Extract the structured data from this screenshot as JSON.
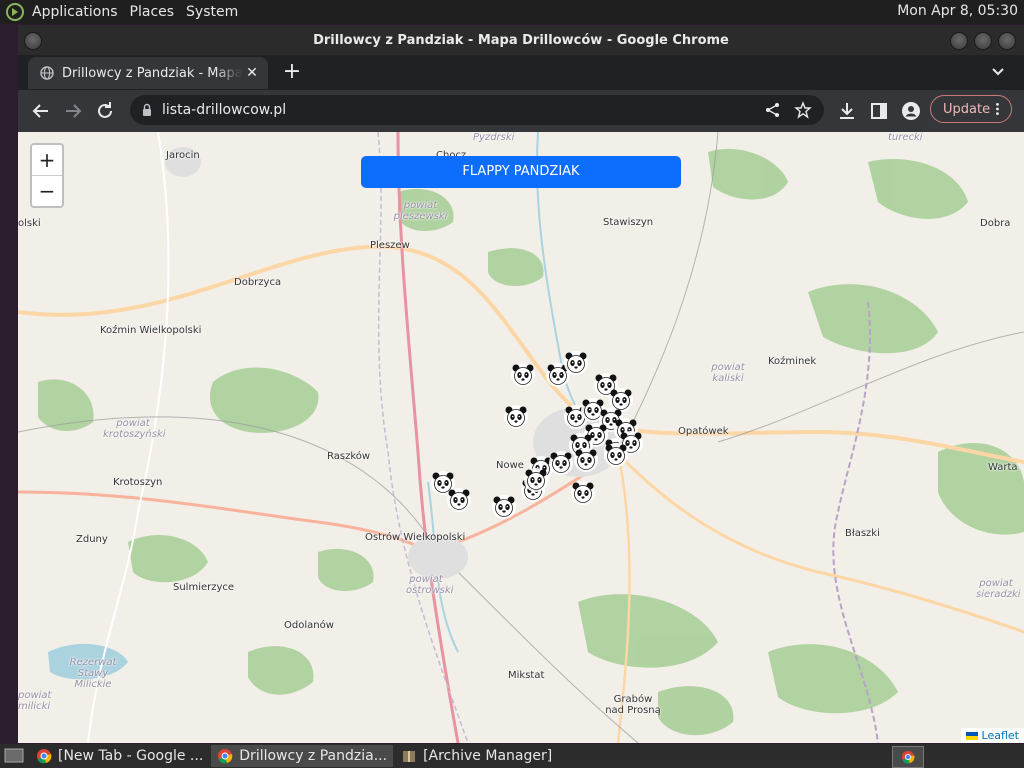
{
  "top_panel": {
    "menus": [
      "Applications",
      "Places",
      "System"
    ],
    "clock": "Mon Apr  8, 05:30"
  },
  "window": {
    "title": "Drillowcy z Pandziak - Mapa Drillowców - Google Chrome"
  },
  "tabs": [
    {
      "label": "Drillowcy z Pandziak - Mapa Drillowców",
      "icon": "globe-icon"
    }
  ],
  "toolbar": {
    "url": "lista-drillowcow.pl",
    "update_label": "Update"
  },
  "map": {
    "zoom_in": "+",
    "zoom_out": "−",
    "flappy_button": "FLAPPY PANDZIAK",
    "attribution": "Leaflet",
    "places": [
      {
        "name": "Jarocin"
      },
      {
        "name": "Chocz"
      },
      {
        "name": "powiat pleszewski"
      },
      {
        "name": "Stawiszyn"
      },
      {
        "name": "olski"
      },
      {
        "name": "Pleszew"
      },
      {
        "name": "Dobra"
      },
      {
        "name": "Dobrzyca"
      },
      {
        "name": "Koźmin Wielkopolski"
      },
      {
        "name": "Koźminek"
      },
      {
        "name": "powiat kaliski"
      },
      {
        "name": "powiat krotoszyński"
      },
      {
        "name": "Opatówek"
      },
      {
        "name": "Raszków"
      },
      {
        "name": "Nowe"
      },
      {
        "name": "Warta"
      },
      {
        "name": "Krotoszyn"
      },
      {
        "name": "Zduny"
      },
      {
        "name": "Ostrów Wielkopolski"
      },
      {
        "name": "Błaszki"
      },
      {
        "name": "powiat ostrowski"
      },
      {
        "name": "Sulmierzyce"
      },
      {
        "name": "powiat sieradzki"
      },
      {
        "name": "Odolanów"
      },
      {
        "name": "Rezerwat Stawy Milickie"
      },
      {
        "name": "Mikstat"
      },
      {
        "name": "Grabów nad Prosną"
      },
      {
        "name": "powiat milicki"
      },
      {
        "name": "turecki"
      },
      {
        "name": "Pyzdrski"
      }
    ]
  },
  "taskbar": {
    "tasks": [
      {
        "label": "[New Tab - Google ...",
        "icon": "chrome-icon"
      },
      {
        "label": "Drillowcy z Pandzia...",
        "icon": "chrome-icon"
      },
      {
        "label": "[Archive Manager]",
        "icon": "archive-icon"
      }
    ]
  },
  "colors": {
    "accent_button": "#0d6efd",
    "map_bg": "#f2efe9",
    "forest": "#add19e",
    "update_border": "#c97a77"
  }
}
